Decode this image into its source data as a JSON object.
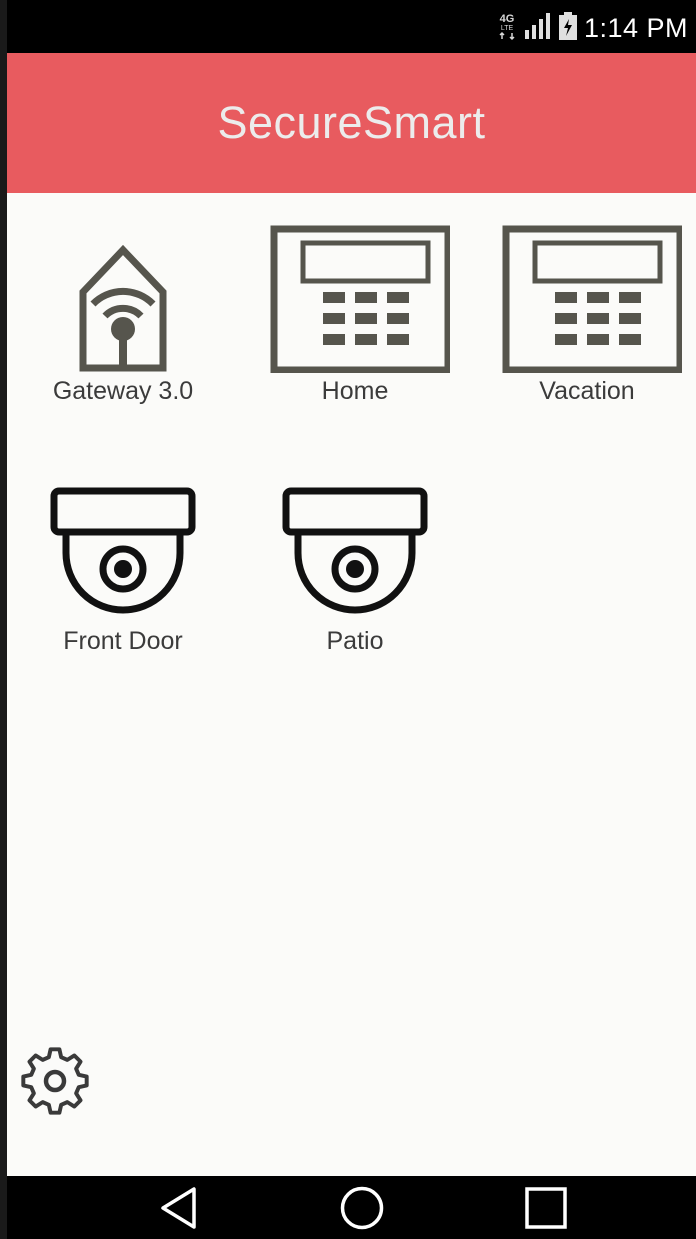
{
  "status_bar": {
    "network": "4G LTE",
    "time": "1:14 PM",
    "icons": [
      "network-4g-icon",
      "signal-icon",
      "battery-charging-icon"
    ]
  },
  "app_bar": {
    "title": "SecureSmart"
  },
  "devices": [
    {
      "label": "Gateway 3.0",
      "icon": "gateway-home-wifi-icon"
    },
    {
      "label": "Home",
      "icon": "alarm-keypad-icon"
    },
    {
      "label": "Vacation",
      "icon": "alarm-keypad-icon"
    },
    {
      "label": "Front Door",
      "icon": "dome-camera-icon"
    },
    {
      "label": "Patio",
      "icon": "dome-camera-icon"
    }
  ],
  "settings": {
    "icon": "gear-icon"
  },
  "nav_bar": {
    "icons": [
      "back-triangle-icon",
      "home-circle-icon",
      "recents-square-icon"
    ]
  },
  "colors": {
    "app_bar": "#e85b5f",
    "icon_gray": "#56554d",
    "background": "#fbfbf9"
  }
}
